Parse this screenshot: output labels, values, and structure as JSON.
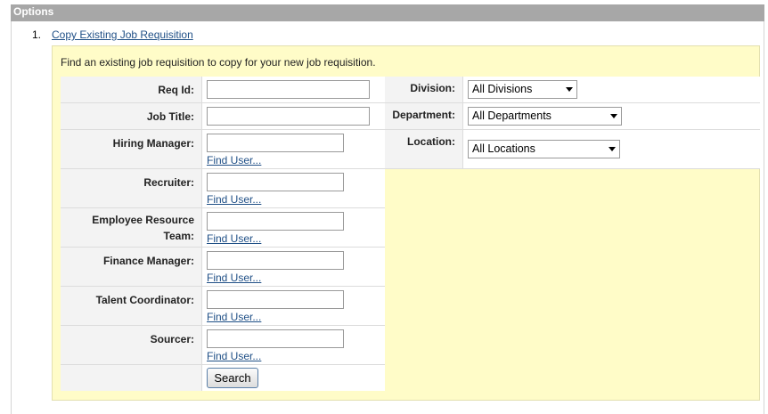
{
  "header": {
    "title": "Options"
  },
  "step": {
    "number": "1.",
    "link_label": "Copy Existing Job Requisition"
  },
  "instruction": "Find an existing job requisition to copy for your new job requisition.",
  "left_fields": [
    {
      "label": "Req Id:",
      "value": ""
    },
    {
      "label": "Job Title:",
      "value": ""
    },
    {
      "label": "Hiring Manager:",
      "value": "",
      "find_user": "Find User..."
    },
    {
      "label": "Recruiter:",
      "value": "",
      "find_user": "Find User..."
    },
    {
      "label": "Employee Resource Team:",
      "value": "",
      "find_user": "Find User..."
    },
    {
      "label": "Finance Manager:",
      "value": "",
      "find_user": "Find User..."
    },
    {
      "label": "Talent Coordinator:",
      "value": "",
      "find_user": "Find User..."
    },
    {
      "label": "Sourcer:",
      "value": "",
      "find_user": "Find User..."
    }
  ],
  "right_fields": [
    {
      "label": "Division:",
      "selected": "All Divisions"
    },
    {
      "label": "Department:",
      "selected": "All Departments"
    },
    {
      "label": "Location:",
      "selected": "All Locations"
    }
  ],
  "search_button": "Search"
}
